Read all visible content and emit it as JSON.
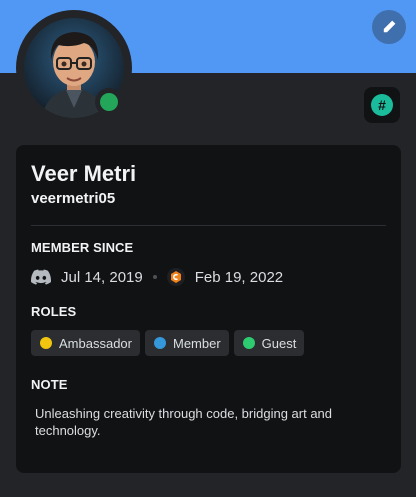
{
  "profile": {
    "display_name": "Veer Metri",
    "username": "veermetri05",
    "status": "online",
    "banner_color": "#5198f4",
    "status_color": "#23a55a"
  },
  "header": {
    "edit_icon": "pencil-icon",
    "badge_icon": "hashtag-badge-icon",
    "badge_glyph": "#"
  },
  "member_since": {
    "title": "MEMBER SINCE",
    "discord_icon": "discord-icon",
    "discord_date": "Jul 14, 2019",
    "server_icon": "server-icon",
    "server_date": "Feb 19, 2022"
  },
  "roles": {
    "title": "ROLES",
    "items": [
      {
        "label": "Ambassador",
        "color": "#f1c40f"
      },
      {
        "label": "Member",
        "color": "#3498db"
      },
      {
        "label": "Guest",
        "color": "#2ecc71"
      }
    ]
  },
  "note": {
    "title": "NOTE",
    "text": "Unleashing creativity through code, bridging art and technology."
  }
}
